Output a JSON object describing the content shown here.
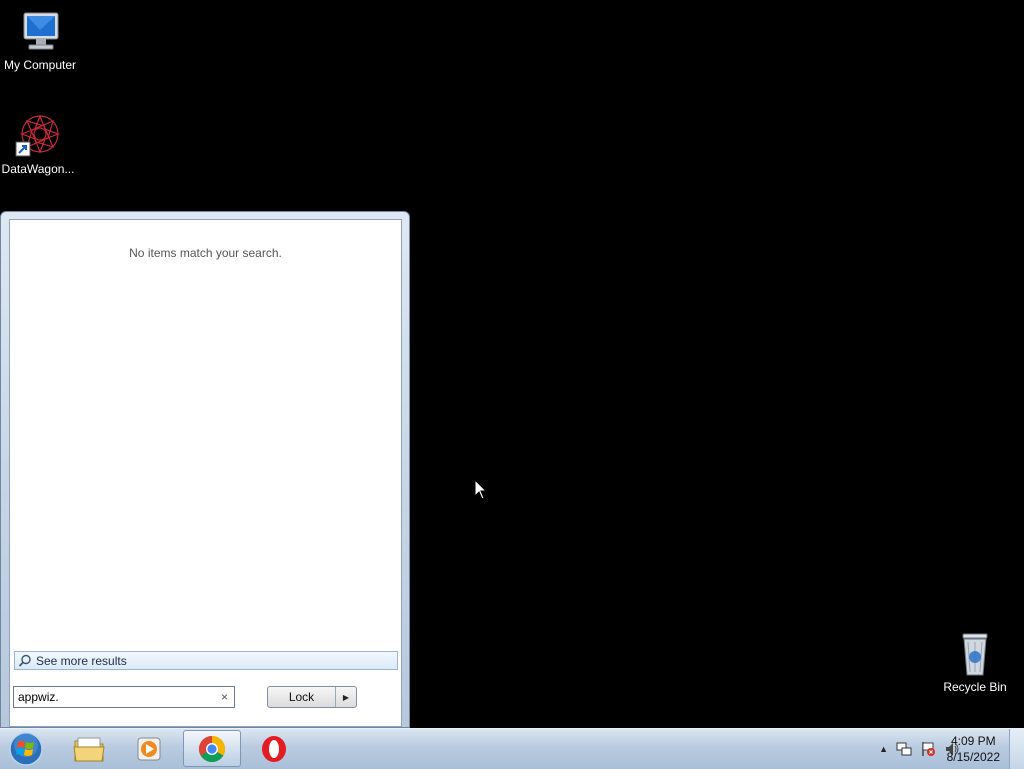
{
  "desktop": {
    "icons": [
      {
        "label": "My Computer",
        "icon": "computer-icon"
      },
      {
        "label": "DataWagon...",
        "icon": "datawagon-shortcut-icon"
      },
      {
        "label": "Recycle Bin",
        "icon": "recycle-bin-icon"
      }
    ]
  },
  "start_menu": {
    "no_results_text": "No items match your search.",
    "see_more_label": "See more results",
    "search_value": "appwiz.",
    "clear_symbol": "×",
    "power_button_label": "Lock",
    "power_arrow": "▶"
  },
  "taskbar": {
    "pinned": [
      {
        "name": "start-orb",
        "icon": "windows-orb-icon"
      },
      {
        "name": "file-explorer",
        "icon": "folder-icon"
      },
      {
        "name": "media-player",
        "icon": "media-player-icon"
      },
      {
        "name": "chrome",
        "icon": "chrome-icon",
        "active": true
      },
      {
        "name": "opera",
        "icon": "opera-icon"
      }
    ],
    "tray_icons": [
      "show-hidden-icons-arrow",
      "network-icon",
      "action-center-flag-icon",
      "volume-icon"
    ],
    "clock": {
      "time": "4:09 PM",
      "date": "8/15/2022"
    }
  },
  "colors": {
    "desktop_bg": "#000000",
    "taskbar_bg": "#b9cbe0",
    "see_more_border": "#9bb4d1"
  }
}
